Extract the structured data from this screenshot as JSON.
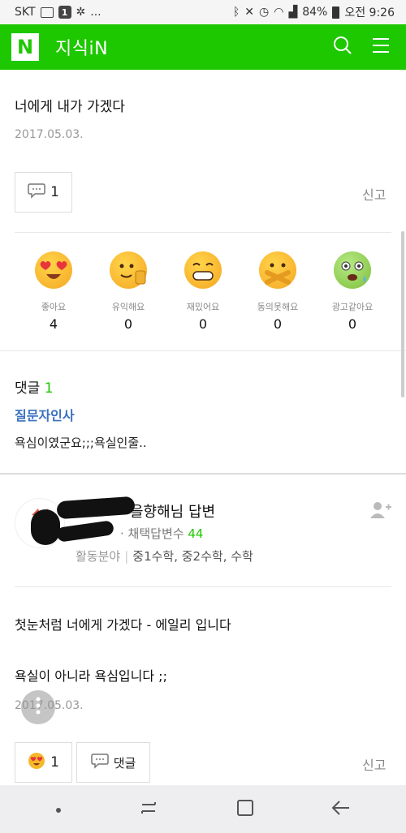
{
  "status_bar": {
    "carrier": "SKT",
    "notif_count": "1",
    "dots": "...",
    "battery": "84%",
    "time": "오전 9:26"
  },
  "header": {
    "logo": "N",
    "title": "지식iN"
  },
  "question": {
    "title": "너에게 내가 가겠다",
    "date": "2017.05.03.",
    "comment_count": "1",
    "report_label": "신고"
  },
  "reactions": [
    {
      "label": "좋아요",
      "count": "4",
      "icon": "heart-eyes-emoji"
    },
    {
      "label": "유익해요",
      "count": "0",
      "icon": "thumbs-up-emoji"
    },
    {
      "label": "재밌어요",
      "count": "0",
      "icon": "grin-emoji"
    },
    {
      "label": "동의못해요",
      "count": "0",
      "icon": "crossed-arms-emoji"
    },
    {
      "label": "광고같아요",
      "count": "0",
      "icon": "sick-emoji"
    }
  ],
  "comments": {
    "label": "댓글",
    "count": "1",
    "author": "질문자인사",
    "body": "욕심이였군요;;;욕실인줄.."
  },
  "answer": {
    "author_suffix": "을향해님 답변",
    "adopted_label": "채택답변수",
    "adopted_count": "44",
    "field_label": "활동분야",
    "fields": "중1수학, 중2수학, 수학",
    "line1": "첫눈처럼 너에게 가겠다 - 에일리 입니다",
    "line2": "욕실이 아니라 욕심입니다 ;;",
    "date": "2017.05.03.",
    "reaction_count": "1",
    "reply_label": "댓글",
    "report_label": "신고"
  }
}
